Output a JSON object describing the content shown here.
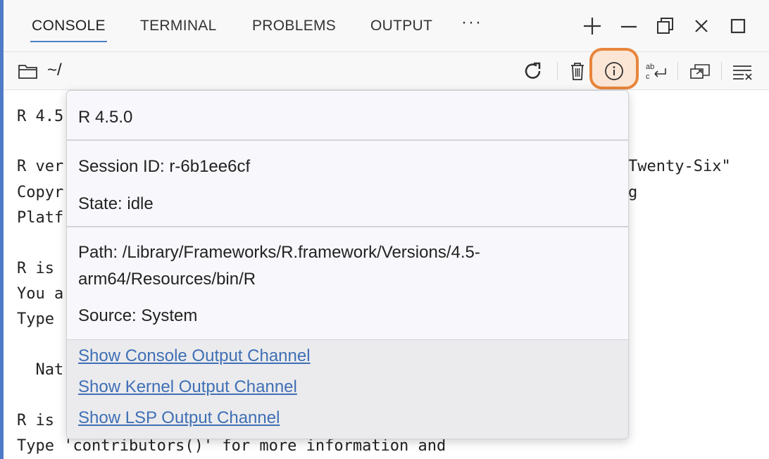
{
  "tabs": [
    {
      "label": "CONSOLE",
      "active": true
    },
    {
      "label": "TERMINAL"
    },
    {
      "label": "PROBLEMS"
    },
    {
      "label": "OUTPUT"
    }
  ],
  "tab_more": "···",
  "toolbar": {
    "path": "~/"
  },
  "console_lines": [
    "R 4.5",
    "R ver",
    "Copyr",
    "Platf",
    "R is",
    "You a",
    "Type",
    "  Nat",
    "R is",
    "Type 'contributors()' for more information and"
  ],
  "console_right": {
    "line1": "Twenty-Six\"",
    "line2": "g"
  },
  "popup": {
    "version": "R 4.5.0",
    "session_id": "Session ID: r-6b1ee6cf",
    "state": "State: idle",
    "path_line1": "Path: /Library/Frameworks/R.framework/Versions/4.5-",
    "path_line2": "arm64/Resources/bin/R",
    "source": "Source: System",
    "links": [
      "Show Console Output Channel",
      "Show Kernel Output Channel",
      "Show LSP Output Channel"
    ]
  },
  "colors": {
    "accent": "#4a80c8",
    "highlight": "#e8853c",
    "link": "#3f6fb5"
  }
}
